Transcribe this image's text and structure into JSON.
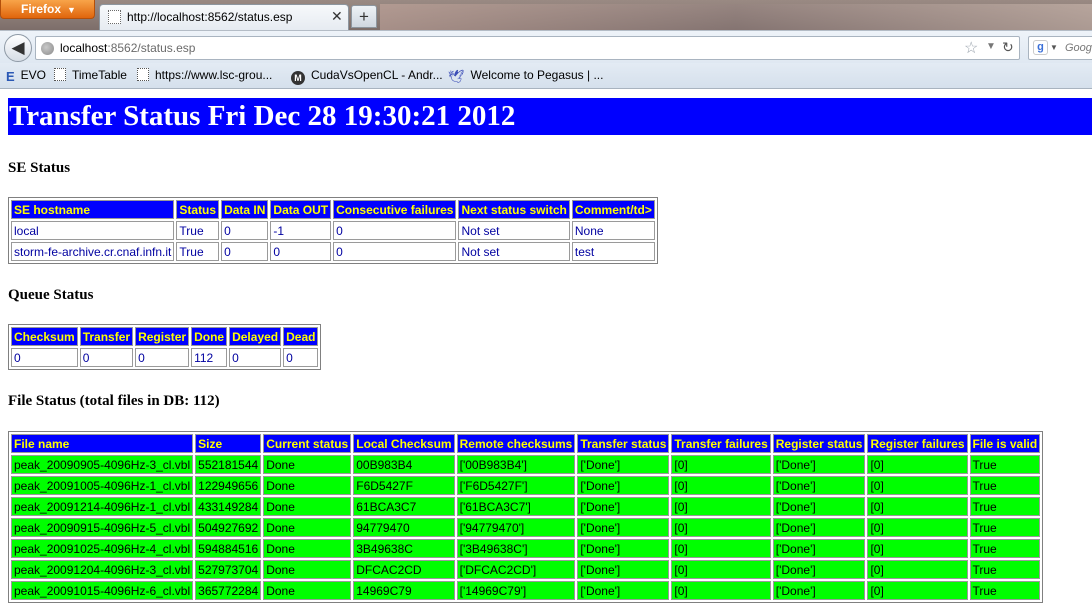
{
  "browser": {
    "menu_button": "Firefox",
    "tab_title": "http://localhost:8562/status.esp",
    "new_tab_label": "+",
    "url_host": "localhost",
    "url_rest": ":8562/status.esp",
    "search_placeholder": "Goog"
  },
  "bookmarks": [
    {
      "label": "EVO",
      "icon": "evo-icon"
    },
    {
      "label": "TimeTable",
      "icon": "page-icon"
    },
    {
      "label": "https://www.lsc-grou...",
      "icon": "page-icon"
    },
    {
      "label": "CudaVsOpenCL - Andr...",
      "icon": "wiki-icon"
    },
    {
      "label": "Welcome to Pegasus | ...",
      "icon": "pegasus-icon"
    }
  ],
  "page": {
    "banner": "Transfer Status Fri Dec 28 19:30:21 2012",
    "se_heading": "SE Status",
    "queue_heading": "Queue Status",
    "file_heading": "File Status (total files in DB: 112)"
  },
  "se_table": {
    "headers": [
      "SE hostname",
      "Status",
      "Data IN",
      "Data OUT",
      "Consecutive failures",
      "Next status switch",
      "Comment/td>"
    ],
    "rows": [
      [
        "local",
        "True",
        "0",
        "-1",
        "0",
        "Not set",
        "None"
      ],
      [
        "storm-fe-archive.cr.cnaf.infn.it",
        "True",
        "0",
        "0",
        "0",
        "Not set",
        "test"
      ]
    ]
  },
  "queue_table": {
    "headers": [
      "Checksum",
      "Transfer",
      "Register",
      "Done",
      "Delayed",
      "Dead"
    ],
    "rows": [
      [
        "0",
        "0",
        "0",
        "112",
        "0",
        "0"
      ]
    ]
  },
  "file_table": {
    "headers": [
      "File name",
      "Size",
      "Current status",
      "Local Checksum",
      "Remote checksums",
      "Transfer status",
      "Transfer failures",
      "Register status",
      "Register failures",
      "File is valid"
    ],
    "rows": [
      [
        "peak_20090905-4096Hz-3_cl.vbl",
        "552181544",
        "Done",
        "00B983B4",
        "['00B983B4']",
        "['Done']",
        "[0]",
        "['Done']",
        "[0]",
        "True"
      ],
      [
        "peak_20091005-4096Hz-1_cl.vbl",
        "122949656",
        "Done",
        "F6D5427F",
        "['F6D5427F']",
        "['Done']",
        "[0]",
        "['Done']",
        "[0]",
        "True"
      ],
      [
        "peak_20091214-4096Hz-1_cl.vbl",
        "433149284",
        "Done",
        "61BCA3C7",
        "['61BCA3C7']",
        "['Done']",
        "[0]",
        "['Done']",
        "[0]",
        "True"
      ],
      [
        "peak_20090915-4096Hz-5_cl.vbl",
        "504927692",
        "Done",
        "94779470",
        "['94779470']",
        "['Done']",
        "[0]",
        "['Done']",
        "[0]",
        "True"
      ],
      [
        "peak_20091025-4096Hz-4_cl.vbl",
        "594884516",
        "Done",
        "3B49638C",
        "['3B49638C']",
        "['Done']",
        "[0]",
        "['Done']",
        "[0]",
        "True"
      ],
      [
        "peak_20091204-4096Hz-3_cl.vbl",
        "527973704",
        "Done",
        "DFCAC2CD",
        "['DFCAC2CD']",
        "['Done']",
        "[0]",
        "['Done']",
        "[0]",
        "True"
      ],
      [
        "peak_20091015-4096Hz-6_cl.vbl",
        "365772284",
        "Done",
        "14969C79",
        "['14969C79']",
        "['Done']",
        "[0]",
        "['Done']",
        "[0]",
        "True"
      ]
    ]
  }
}
